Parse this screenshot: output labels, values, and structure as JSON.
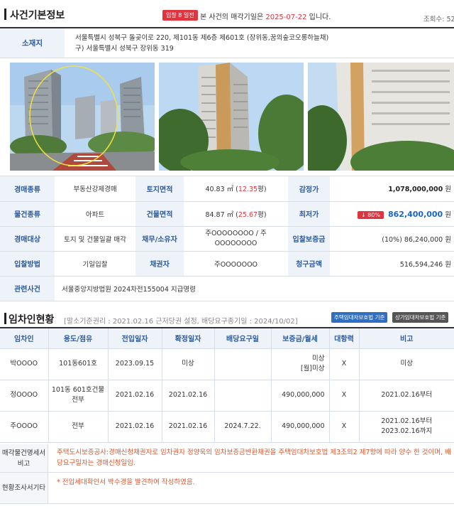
{
  "case_info": {
    "title": "사건기본정보",
    "badge": "입찰 8 일전",
    "notice_prefix": "본 사건의 매각기일은 ",
    "notice_date": "2025-07-22",
    "notice_suffix": " 입니다.",
    "views": "조회수: 52",
    "address_label": "소재지",
    "address_line1": "서울특별시 성북구 돌곶이로 220, 제101동 제6층 제601호 (장위동,꿈의숲코오롱하늘채)",
    "address_line2": "구) 서울특별시 성북구 장위동 319"
  },
  "info_rows": [
    {
      "c1_label": "경매종류",
      "c1_value": "부동산강제경매",
      "c2_label": "토지면적",
      "c2_value": "40.83 ㎡ (",
      "c2_red": "12.35",
      "c2_after": "평)",
      "c3_label": "감정가",
      "c3_value": "1,078,000,000",
      "c3_unit": "원"
    },
    {
      "c1_label": "물건종류",
      "c1_value": "아파트",
      "c2_label": "건물면적",
      "c2_value": "84.87 ㎡ (",
      "c2_red": "25.67",
      "c2_after": "평)",
      "c3_label": "최저가",
      "c3_drop": "↓ 80%",
      "c3_value": "862,400,000",
      "c3_unit": "원"
    },
    {
      "c1_label": "경매대상",
      "c1_value": "토지 및 건물일괄 매각",
      "c2_label": "채무/소유자",
      "c2_value": "주OOOOOOOO / 주OOOOOOOO",
      "c3_label": "입찰보증금",
      "c3_value": "(10%) 86,240,000",
      "c3_unit": "원"
    },
    {
      "c1_label": "입찰방법",
      "c1_value": "기일입찰",
      "c2_label": "채권자",
      "c2_value": "주OOOOOOO",
      "c3_label": "청구금액",
      "c3_value": "516,594,246",
      "c3_unit": "원"
    }
  ],
  "related": {
    "label": "관련사건",
    "value": "서울중앙지방법원 2024차전155004 지급명령"
  },
  "tenant_section": {
    "title": "임차인현황",
    "sub": "[말소기준권리 : 2021.02.16 근저당권 설정, 배당요구종기일 : 2024/10/02]",
    "btn1": "주택임대차보호법 기준",
    "btn2": "상가임대차보호법 기준",
    "headers": [
      "임차인",
      "용도/점유",
      "전입일자",
      "확정일자",
      "배당요구일",
      "보증금/월세",
      "대항력",
      "비고"
    ],
    "rows": [
      {
        "name": "박OOOO",
        "use": "101동601호",
        "move_in": "2023.09.15",
        "fixed": "미상",
        "claim": "",
        "deposit_1": "미상",
        "deposit_2": "[월]미상",
        "opposing": "X",
        "note_1": "미상",
        "note_2": ""
      },
      {
        "name": "정OOOO",
        "use": "101동 601호건물 전부",
        "move_in": "2021.02.16",
        "fixed": "2021.02.16",
        "claim": "",
        "deposit_1": "490,000,000",
        "deposit_2": "",
        "opposing": "X",
        "note_1": "2021.02.16부터",
        "note_2": ""
      },
      {
        "name": "주OOOO",
        "use": "전부",
        "move_in": "2021.02.16",
        "fixed": "2021.02.16",
        "claim": "2024.7.22.",
        "deposit_1": "490,000,000",
        "deposit_2": "",
        "opposing": "X",
        "note_1": "2021.02.16부터",
        "note_2": "2023.02.16까지"
      }
    ],
    "note1_label": "매각물건명세서비고",
    "note1_text": "주택도시보증공사:경매신청채권자로 임차권자 정양욱의 임차보증금반환채권을 주택임대차보호법 제3조의2 제7항에 따라 양수 한 것이며, 배당요구일자는 경매신청일임.",
    "note2_label": "현황조사서기타",
    "note2_text": "* 전입세대확인서 박수경을 발견하여 작성하였음."
  },
  "colors": {
    "accent_red": "#e0343e",
    "label_blue": "#2c5a9a",
    "price_blue": "#1b64c8",
    "note_orange": "#e0552b"
  }
}
